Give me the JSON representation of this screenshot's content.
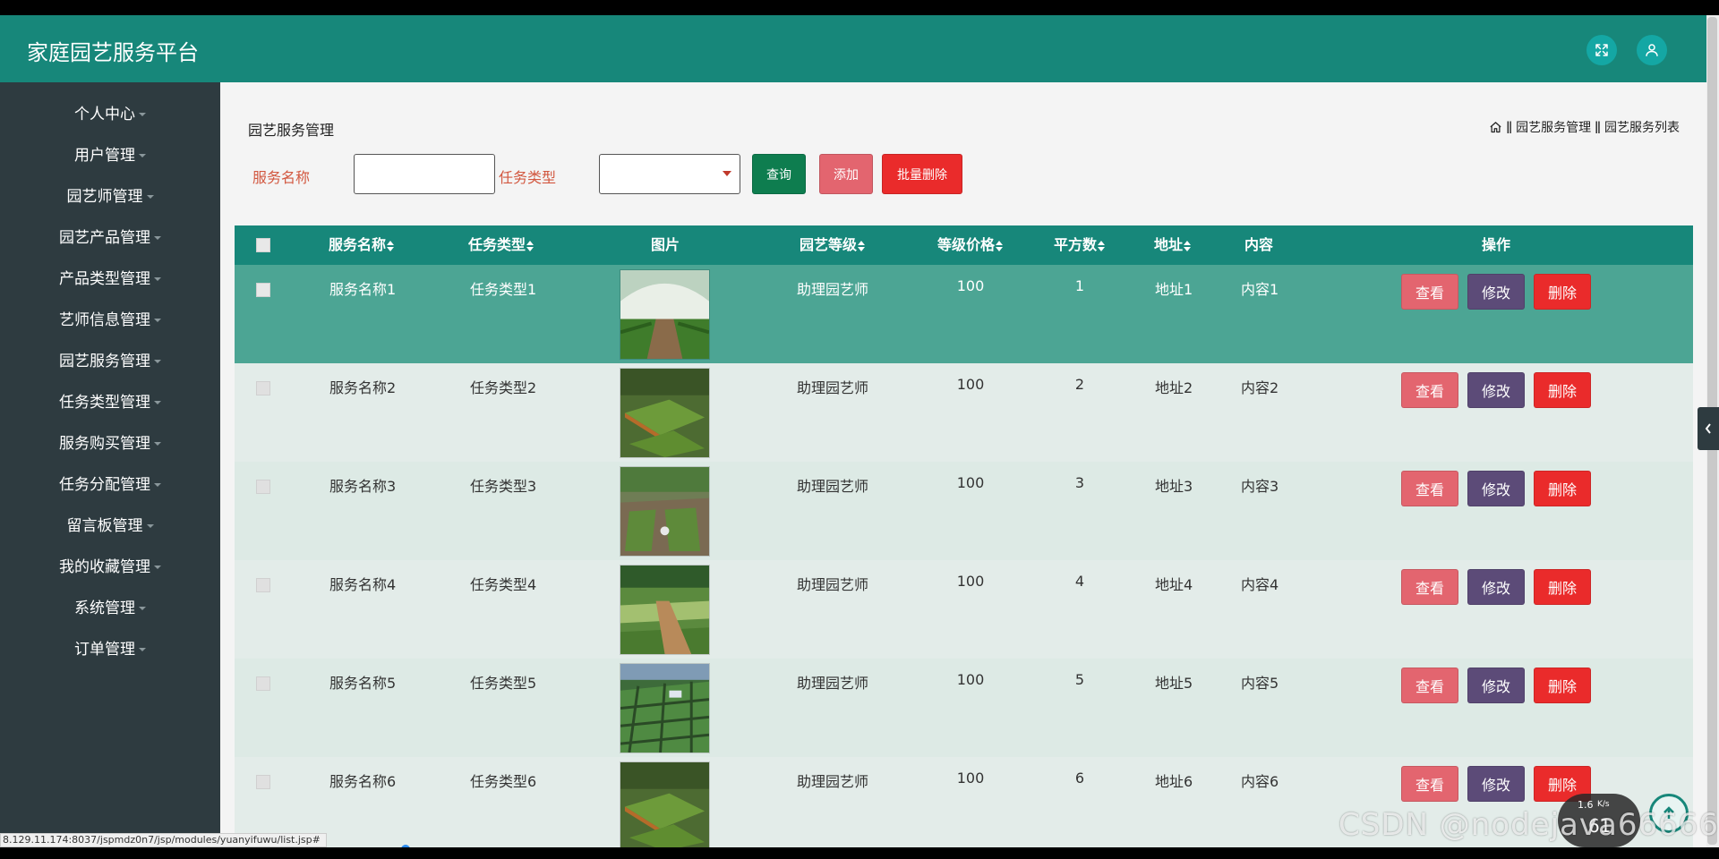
{
  "app": {
    "title": "家庭园艺服务平台"
  },
  "header": {
    "fullscreen_icon": "expand-icon",
    "user_icon": "user-icon"
  },
  "sidebar": {
    "items": [
      {
        "label": "个人中心"
      },
      {
        "label": "用户管理"
      },
      {
        "label": "园艺师管理"
      },
      {
        "label": "园艺产品管理"
      },
      {
        "label": "产品类型管理"
      },
      {
        "label": "艺师信息管理"
      },
      {
        "label": "园艺服务管理"
      },
      {
        "label": "任务类型管理"
      },
      {
        "label": "服务购买管理"
      },
      {
        "label": "任务分配管理"
      },
      {
        "label": "留言板管理"
      },
      {
        "label": "我的收藏管理"
      },
      {
        "label": "系统管理"
      },
      {
        "label": "订单管理"
      }
    ]
  },
  "page": {
    "title": "园艺服务管理",
    "breadcrumb": {
      "sep": "ǁ",
      "level1": "园艺服务管理",
      "level2": "园艺服务列表"
    }
  },
  "search": {
    "name_label": "服务名称",
    "name_value": "",
    "type_label": "任务类型",
    "type_value": "",
    "query_button": "查询",
    "add_button": "添加",
    "batch_delete_button": "批量删除"
  },
  "table": {
    "headers": {
      "name": "服务名称",
      "type": "任务类型",
      "image": "图片",
      "level": "园艺等级",
      "price": "等级价格",
      "area": "平方数",
      "address": "地址",
      "content": "内容",
      "actions": "操作"
    },
    "rows": [
      {
        "name": "服务名称1",
        "type": "任务类型1",
        "level": "助理园艺师",
        "price": "100",
        "area": "1",
        "address": "地址1",
        "content": "内容1"
      },
      {
        "name": "服务名称2",
        "type": "任务类型2",
        "level": "助理园艺师",
        "price": "100",
        "area": "2",
        "address": "地址2",
        "content": "内容2"
      },
      {
        "name": "服务名称3",
        "type": "任务类型3",
        "level": "助理园艺师",
        "price": "100",
        "area": "3",
        "address": "地址3",
        "content": "内容3"
      },
      {
        "name": "服务名称4",
        "type": "任务类型4",
        "level": "助理园艺师",
        "price": "100",
        "area": "4",
        "address": "地址4",
        "content": "内容4"
      },
      {
        "name": "服务名称5",
        "type": "任务类型5",
        "level": "助理园艺师",
        "price": "100",
        "area": "5",
        "address": "地址5",
        "content": "内容5"
      },
      {
        "name": "服务名称6",
        "type": "任务类型6",
        "level": "助理园艺师",
        "price": "100",
        "area": "6",
        "address": "地址6",
        "content": "内容6"
      }
    ],
    "actions": {
      "view": "查看",
      "edit": "修改",
      "delete": "删除"
    }
  },
  "status": {
    "url": "8.129.11.174:8037/jspmdz0n7/jsp/modules/yuanyifuwu/list.jsp#",
    "net_speed": "1.6",
    "net_unit": "K/s",
    "net_percent": "61",
    "watermark": "CSDN @nodejava666666"
  },
  "colors": {
    "primary": "#17877a",
    "sidebar": "#2e3b40",
    "view": "#e3656f",
    "edit": "#5c4b78",
    "delete": "#ea2b2b",
    "query": "#0e7d4f"
  }
}
